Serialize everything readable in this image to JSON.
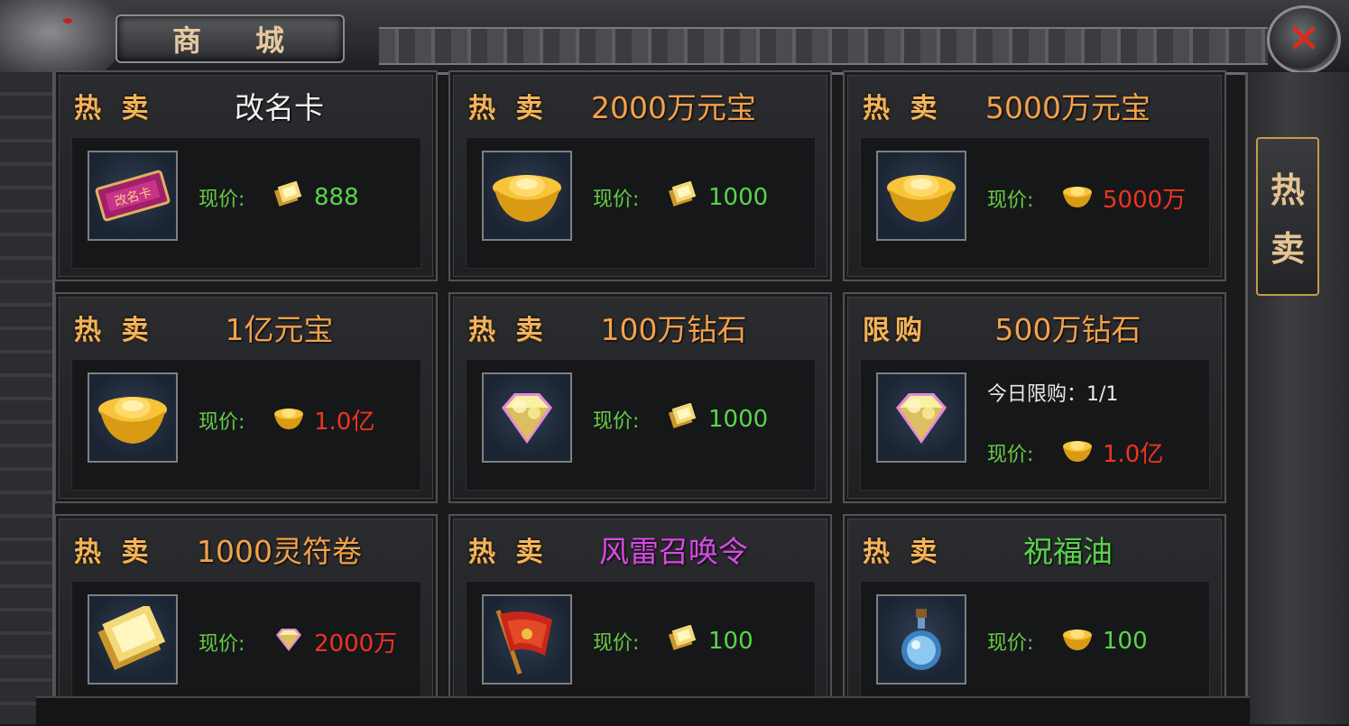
{
  "window": {
    "title_chars": [
      "商",
      "城"
    ],
    "close_icon": "close-x",
    "side_tab_chars": [
      "热",
      "卖"
    ]
  },
  "labels": {
    "price": "现价:"
  },
  "colors": {
    "tag": "#f3b35a",
    "name_white": "#f0f0f0",
    "name_orange": "#f2a14c",
    "name_purple": "#d84ae6",
    "name_green": "#58d64a",
    "price_green": "#58d64a",
    "price_red": "#ee3322"
  },
  "items": [
    {
      "tag": "热 卖",
      "name": "改名卡",
      "name_color": "name_white",
      "icon": "rename-card-icon",
      "currency": "ticket-currency-icon",
      "price": "888",
      "price_color": "green",
      "limit": ""
    },
    {
      "tag": "热 卖",
      "name": "2000万元宝",
      "name_color": "name_orange",
      "icon": "gold-ingot-icon",
      "currency": "ticket-currency-icon",
      "price": "1000",
      "price_color": "green",
      "limit": ""
    },
    {
      "tag": "热 卖",
      "name": "5000万元宝",
      "name_color": "name_orange",
      "icon": "gold-ingot-icon",
      "currency": "ingot-currency-icon",
      "price": "5000万",
      "price_color": "red",
      "limit": ""
    },
    {
      "tag": "热 卖",
      "name": "1亿元宝",
      "name_color": "name_orange",
      "icon": "gold-ingot-icon",
      "currency": "ingot-currency-icon",
      "price": "1.0亿",
      "price_color": "red",
      "limit": ""
    },
    {
      "tag": "热 卖",
      "name": "100万钻石",
      "name_color": "name_orange",
      "icon": "diamond-icon",
      "currency": "ticket-currency-icon",
      "price": "1000",
      "price_color": "green",
      "limit": ""
    },
    {
      "tag": "限购",
      "name": "500万钻石",
      "name_color": "name_orange",
      "icon": "diamond-icon",
      "currency": "ingot-currency-icon",
      "price": "1.0亿",
      "price_color": "red",
      "limit": "今日限购：1/1"
    },
    {
      "tag": "热 卖",
      "name": "1000灵符卷",
      "name_color": "name_orange",
      "icon": "talisman-scroll-icon",
      "currency": "diamond-currency-icon",
      "price": "2000万",
      "price_color": "red",
      "limit": ""
    },
    {
      "tag": "热 卖",
      "name": "风雷召唤令",
      "name_color": "name_purple",
      "icon": "summon-flag-icon",
      "currency": "ticket-currency-icon",
      "price": "100",
      "price_color": "green",
      "limit": ""
    },
    {
      "tag": "热 卖",
      "name": "祝福油",
      "name_color": "name_green",
      "icon": "blessing-oil-icon",
      "currency": "ingot-currency-icon",
      "price": "100",
      "price_color": "green",
      "limit": ""
    }
  ]
}
